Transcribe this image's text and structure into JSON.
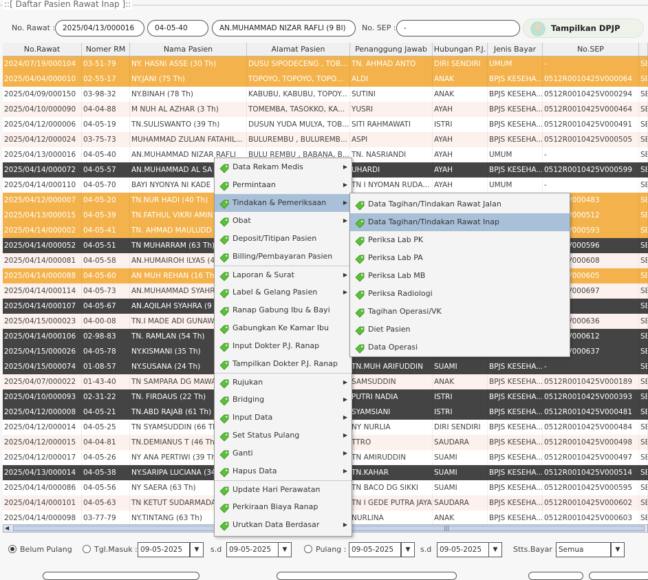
{
  "window_title": "::[ Daftar Pasien Rawat Inap ]::",
  "toolbar": {
    "no_rawat_label": "No. Rawat :",
    "no_rawat_value": "2025/04/13/000016",
    "no_rm_value": "04-05-40",
    "patient_value": "AN.MUHAMMAD NIZAR RAFLI (9 Bl)",
    "no_sep_label": "No. SEP :",
    "no_sep_value": "-",
    "dpjp_button": "Tampilkan DPJP Ranap"
  },
  "table": {
    "columns": [
      "No.Rawat",
      "Nomer RM",
      "Nama Pasien",
      "Alamat Pasien",
      "Penanggung Jawab",
      "Hubungan P.J.",
      "Jenis Bayar",
      "No.SEP",
      ""
    ],
    "rows": [
      {
        "style": "orange",
        "cells": [
          "2024/07/19/000104",
          "03-51-79",
          "NY. HASNI ASSE (30 Th)",
          "DUSU SIPODECENG , TOB...",
          "TN. AHMAD ANTO",
          "DIRI SENDIRI",
          "UMUM",
          "-",
          "SE"
        ]
      },
      {
        "style": "orange",
        "cells": [
          "2025/04/04/000010",
          "02-55-17",
          "NY.JANI (75 Th)",
          "TOPOYO, TOPOYO, TOPO...",
          "ALDI",
          "ANAK",
          "BPJS KESEHA...",
          "0512R0010425V000064",
          "SE"
        ]
      },
      {
        "style": "white",
        "cells": [
          "2025/04/09/000150",
          "03-98-32",
          "NY.BINAH (78 Th)",
          "KABUBU, KABUBU, TOPOY...",
          "SUTINI",
          "ANAK",
          "BPJS KESEHA...",
          "0512R0010425V000294",
          "SE"
        ]
      },
      {
        "style": "pink",
        "cells": [
          "2025/04/10/000090",
          "04-04-88",
          "M NUH AL AZHAR (3 Th)",
          "TOMEMBA, TASOKKO, KA...",
          "YUSRI",
          "AYAH",
          "BPJS KESEHA...",
          "0512R0010425V000464",
          "SE"
        ]
      },
      {
        "style": "white",
        "cells": [
          "2025/04/12/000006",
          "04-05-19",
          "TN.SULISWANTO (39 Th)",
          "DUSUN YUDA MULYA, TOB...",
          "SITI RAHMAWATI",
          "ISTRI",
          "BPJS KESEHA...",
          "0512R0010425V000491",
          "SE"
        ]
      },
      {
        "style": "pink",
        "cells": [
          "2025/04/12/000024",
          "03-75-73",
          "MUHAMMAD ZULIAN FATAHIL...",
          "BULUREMBU , BULUREMB...",
          "ASPI",
          "AYAH",
          "BPJS KESEHA...",
          "0512R0010425V000505",
          "SE"
        ]
      },
      {
        "style": "white",
        "cells": [
          "2025/04/13/000016",
          "04-05-40",
          "AN.MUHAMMAD NIZAR RAFLI",
          "BULU REMBU , BABANA, B...",
          "TN. NASRIANDI",
          "AYAH",
          "UMUM",
          "-",
          "SE"
        ]
      },
      {
        "style": "dark",
        "cells": [
          "2025/04/14/000072",
          "04-05-57",
          "AN.MUHAMMAD AL SA",
          "",
          "UHARDI",
          "AYAH",
          "BPJS KESEHA...",
          "0512R0010425V000599",
          "SE"
        ]
      },
      {
        "style": "white",
        "cells": [
          "2025/04/14/000110",
          "04-05-70",
          "BAYI NYONYA NI KADE",
          "",
          "TN I NYOMAN RUDA...",
          "AYAH",
          "UMUM",
          "-",
          "SE"
        ]
      },
      {
        "style": "orange",
        "cells": [
          "2025/04/12/000007",
          "04-05-20",
          "TN.NUR HADI (40 Th)",
          "",
          "",
          "",
          "",
          "10425V000483",
          "SE"
        ]
      },
      {
        "style": "orange",
        "cells": [
          "2025/04/13/000015",
          "04-05-39",
          "TN.FATHUL VIKRI AMIN",
          "",
          "",
          "",
          "",
          "10425V000512",
          "SE"
        ]
      },
      {
        "style": "orange",
        "cells": [
          "2025/04/14/000002",
          "04-05-41",
          "TN. AHMAD MAULUDD",
          "",
          "",
          "",
          "",
          "10425V000593",
          "SE"
        ]
      },
      {
        "style": "dark",
        "cells": [
          "2025/04/14/000052",
          "04-05-51",
          "TN MUHARRAM (63 Th)",
          "",
          "",
          "",
          "",
          "10425V000596",
          "SE"
        ]
      },
      {
        "style": "pink",
        "cells": [
          "2025/04/14/000081",
          "04-05-58",
          "AN.HUMAIROH ILYAS (4",
          "",
          "",
          "",
          "",
          "10425V000608",
          "SE"
        ]
      },
      {
        "style": "orange",
        "cells": [
          "2025/04/14/000088",
          "04-05-60",
          "AN MUH REHAN (16 Th",
          "",
          "",
          "",
          "",
          "10425V000605",
          "SE"
        ]
      },
      {
        "style": "pink",
        "cells": [
          "2025/04/14/000114",
          "04-05-73",
          "AN.MUHAMMAD SYAHR",
          "",
          "",
          "",
          "",
          "10425V000697",
          "SE"
        ]
      },
      {
        "style": "dark",
        "cells": [
          "2025/04/14/000107",
          "04-05-67",
          "AN.AQILAH SYAHRA (9",
          "",
          "",
          "",
          "",
          "",
          "SE"
        ]
      },
      {
        "style": "pink",
        "cells": [
          "2025/04/15/000023",
          "04-00-08",
          "TN.I MADE ADI GUNAW",
          "",
          "",
          "",
          "",
          "10425V000636",
          "SE"
        ]
      },
      {
        "style": "dark",
        "cells": [
          "2025/04/14/000106",
          "02-98-83",
          "TN. RAMLAN (54 Th)",
          "",
          "",
          "",
          "",
          "10425V000612",
          "SE"
        ]
      },
      {
        "style": "dark",
        "cells": [
          "2025/04/15/000026",
          "04-05-78",
          "NY.KISMANI (35 Th)",
          "",
          "",
          "",
          "",
          "10425V000637",
          "SE"
        ]
      },
      {
        "style": "dark",
        "cells": [
          "2025/04/15/000074",
          "01-08-57",
          "NY.SUSANA (24 Th)",
          "",
          "TN.MUH ARIFUDDIN",
          "SUAMI",
          "BPJS KESEHA...",
          "-",
          "SE"
        ]
      },
      {
        "style": "pink",
        "cells": [
          "2025/04/07/000022",
          "01-43-40",
          "TN SAMPARA DG MAWA",
          "",
          "SAMSUDDIN",
          "ANAK",
          "BPJS KESEHA...",
          "0512R0010425V000189",
          "SE"
        ]
      },
      {
        "style": "dark",
        "cells": [
          "2025/04/10/000093",
          "02-31-22",
          "TN. FIRDAUS (22 Th)",
          "",
          "PUTRI NADIA",
          "ISTRI",
          "BPJS KESEHA...",
          "0512R0010425V000393",
          "SE"
        ]
      },
      {
        "style": "dark",
        "cells": [
          "2025/04/12/000008",
          "04-05-21",
          "TN.ABD RAJAB (61 Th)",
          "",
          "SYAMSIANI",
          "ISTRI",
          "BPJS KESEHA...",
          "0512R0010425V000481",
          "SE"
        ]
      },
      {
        "style": "white",
        "cells": [
          "2025/04/12/000014",
          "04-05-25",
          "TN SYAMSUDDIN (66 Th",
          "",
          "NY NURLIA",
          "DIRI SENDIRI",
          "BPJS KESEHA...",
          "0512R0010425V000484",
          "SE"
        ]
      },
      {
        "style": "pink",
        "cells": [
          "2025/04/12/000015",
          "04-04-81",
          "TN.DEMIANUS T (46 Th",
          "",
          "TTRO",
          "SAUDARA",
          "BPJS KESEHA...",
          "0512R0010425V000498",
          "SE"
        ]
      },
      {
        "style": "white",
        "cells": [
          "2025/04/12/000017",
          "04-05-26",
          "NY ANA PERTIWI (39 Th",
          "",
          "TN AMIRUDDIN",
          "SUAMI",
          "BPJS KESEHA...",
          "0512R0010425V000497",
          "SE"
        ]
      },
      {
        "style": "dark",
        "cells": [
          "2025/04/13/000014",
          "04-05-38",
          "NY.SARIPA LUCIANA (34",
          "",
          "TN.KAHAR",
          "SUAMI",
          "BPJS KESEHA...",
          "0512R0010425V000514",
          "SE"
        ]
      },
      {
        "style": "white",
        "cells": [
          "2025/04/14/000086",
          "04-05-56",
          "NY SAERA (63 Th)",
          "",
          "TN BACO DG SIKKI",
          "SUAMI",
          "BPJS KESEHA...",
          "0512R0010425V000595",
          "SE"
        ]
      },
      {
        "style": "pink",
        "cells": [
          "2025/04/14/000101",
          "04-05-63",
          "TN KETUT SUDARMADA",
          "",
          "TN I GEDE PUTRA JAYA",
          "SAUDARA",
          "BPJS KESEHA...",
          "0512R0010425V000602",
          "SE"
        ]
      },
      {
        "style": "white",
        "cells": [
          "2025/04/14/000098",
          "03-77-79",
          "NY.TINTANG (63 Th)",
          "",
          "NURLINA",
          "ANAK",
          "BPJS KESEHA...",
          "0512R0010425V000603",
          "SE"
        ]
      }
    ]
  },
  "context_menu": {
    "items": [
      {
        "label": "Data Rekam Medis",
        "submenu": true,
        "selected": false,
        "separator_before": false
      },
      {
        "label": "Permintaan",
        "submenu": true,
        "selected": false,
        "separator_before": false
      },
      {
        "label": "Tindakan & Pemeriksaan",
        "submenu": true,
        "selected": true,
        "separator_before": false
      },
      {
        "label": "Obat",
        "submenu": true,
        "selected": false,
        "separator_before": false
      },
      {
        "label": "Deposit/Titipan Pasien",
        "submenu": false,
        "selected": false,
        "separator_before": false
      },
      {
        "label": "Billing/Pembayaran Pasien",
        "submenu": false,
        "selected": false,
        "separator_before": false
      },
      {
        "label": "Laporan & Surat",
        "submenu": true,
        "selected": false,
        "separator_before": true
      },
      {
        "label": "Label & Gelang Pasien",
        "submenu": true,
        "selected": false,
        "separator_before": false
      },
      {
        "label": "Ranap Gabung Ibu & Bayi",
        "submenu": false,
        "selected": false,
        "separator_before": false
      },
      {
        "label": "Gabungkan Ke Kamar Ibu",
        "submenu": false,
        "selected": false,
        "separator_before": false
      },
      {
        "label": "Input Dokter P.J. Ranap",
        "submenu": false,
        "selected": false,
        "separator_before": false
      },
      {
        "label": "Tampilkan Dokter P.J. Ranap",
        "submenu": false,
        "selected": false,
        "separator_before": false
      },
      {
        "label": "Rujukan",
        "submenu": true,
        "selected": false,
        "separator_before": true
      },
      {
        "label": "Bridging",
        "submenu": true,
        "selected": false,
        "separator_before": false
      },
      {
        "label": "Input Data",
        "submenu": true,
        "selected": false,
        "separator_before": false
      },
      {
        "label": "Set Status Pulang",
        "submenu": true,
        "selected": false,
        "separator_before": false
      },
      {
        "label": "Ganti",
        "submenu": true,
        "selected": false,
        "separator_before": false
      },
      {
        "label": "Hapus Data",
        "submenu": true,
        "selected": false,
        "separator_before": false
      },
      {
        "label": "Update Hari Perawatan",
        "submenu": false,
        "selected": false,
        "separator_before": true
      },
      {
        "label": "Perkiraan Biaya Ranap",
        "submenu": false,
        "selected": false,
        "separator_before": false
      },
      {
        "label": "Urutkan Data Berdasar",
        "submenu": true,
        "selected": false,
        "separator_before": false
      }
    ]
  },
  "submenu": {
    "items": [
      {
        "label": "Data Tagihan/Tindakan Rawat Jalan",
        "selected": false
      },
      {
        "label": "Data Tagihan/Tindakan Rawat Inap",
        "selected": true
      },
      {
        "label": "Periksa Lab PK",
        "selected": false
      },
      {
        "label": "Periksa Lab PA",
        "selected": false
      },
      {
        "label": "Periksa Lab MB",
        "selected": false
      },
      {
        "label": "Periksa Radiologi",
        "selected": false
      },
      {
        "label": "Tagihan Operasi/VK",
        "selected": false
      },
      {
        "label": "Diet Pasien",
        "selected": false
      },
      {
        "label": "Data Operasi",
        "selected": false
      }
    ]
  },
  "filter": {
    "belum_pulang": "Belum Pulang",
    "tgl_masuk": "Tgl.Masuk :",
    "tgl_masuk_from": "09-05-2025",
    "sd1": "s.d",
    "tgl_masuk_to": "09-05-2025",
    "pulang": "Pulang :",
    "pulang_from": "09-05-2025",
    "sd2": "s.d",
    "pulang_to": "09-05-2025",
    "stts_bayar_label": "Stts.Bayar :",
    "stts_bayar_value": "Semua"
  },
  "colors": {
    "row_orange": "#f3b24b",
    "row_dark": "#444444",
    "row_pink": "#fcf1ec",
    "menu_selected": "#a9c0d9",
    "tag_icon": "#5cbf3a"
  }
}
